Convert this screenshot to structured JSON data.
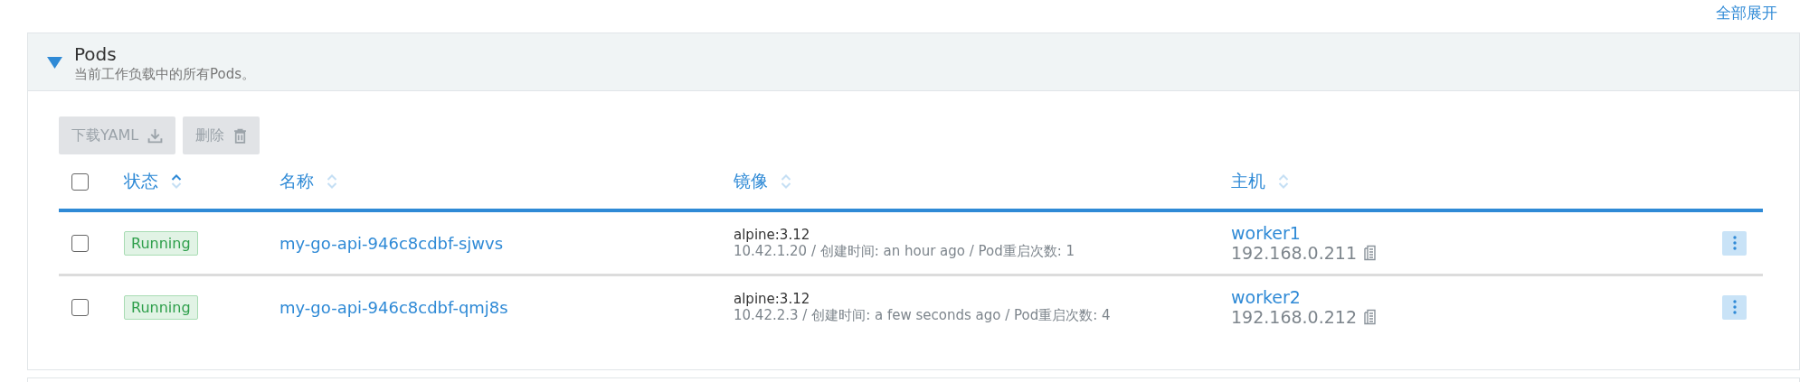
{
  "expand_all_link": "全部展开",
  "section": {
    "title": "Pods",
    "subtitle": "当前工作负载中的所有Pods。",
    "expanded": true
  },
  "toolbar": [
    {
      "label": "下载YAML",
      "kind": "download",
      "disabled": true
    },
    {
      "label": "删除",
      "kind": "delete",
      "disabled": true
    }
  ],
  "table": {
    "select_all_checked": false,
    "columns": [
      {
        "label": "状态",
        "sorted": true
      },
      {
        "label": "名称",
        "sorted": false
      },
      {
        "label": "镜像",
        "sorted": false
      },
      {
        "label": "主机",
        "sorted": false
      }
    ],
    "rows": [
      {
        "checked": false,
        "status": "Running",
        "name": "my-go-api-946c8cdbf-sjwvs",
        "image": "alpine:3.12",
        "details": "10.42.1.20 / 创建时间: an hour ago / Pod重启次数: 1",
        "host": "worker1",
        "host_ip": "192.168.0.211"
      },
      {
        "checked": false,
        "status": "Running",
        "name": "my-go-api-946c8cdbf-qmj8s",
        "image": "alpine:3.12",
        "details": "10.42.2.3 / 创建时间: a few seconds ago / Pod重启次数: 4",
        "host": "worker2",
        "host_ip": "192.168.0.212"
      }
    ]
  }
}
